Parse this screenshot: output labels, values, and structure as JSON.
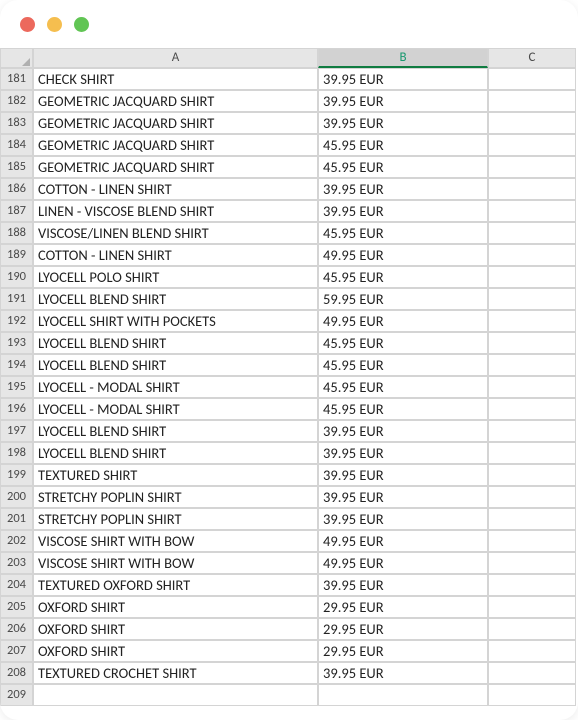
{
  "titlebar": {
    "close": "",
    "minimize": "",
    "zoom": ""
  },
  "chart_data": {
    "type": "table",
    "title": "",
    "columns": [
      "A",
      "B"
    ],
    "rows": [
      {
        "row": 181,
        "A": "CHECK SHIRT",
        "B": "39.95 EUR"
      },
      {
        "row": 182,
        "A": "GEOMETRIC JACQUARD SHIRT",
        "B": "39.95 EUR"
      },
      {
        "row": 183,
        "A": "GEOMETRIC JACQUARD SHIRT",
        "B": "39.95 EUR"
      },
      {
        "row": 184,
        "A": "GEOMETRIC JACQUARD SHIRT",
        "B": "45.95 EUR"
      },
      {
        "row": 185,
        "A": "GEOMETRIC JACQUARD SHIRT",
        "B": "45.95 EUR"
      },
      {
        "row": 186,
        "A": "COTTON - LINEN SHIRT",
        "B": "39.95 EUR"
      },
      {
        "row": 187,
        "A": "LINEN - VISCOSE BLEND SHIRT",
        "B": "39.95 EUR"
      },
      {
        "row": 188,
        "A": "VISCOSE/LINEN BLEND SHIRT",
        "B": "45.95 EUR"
      },
      {
        "row": 189,
        "A": "COTTON - LINEN SHIRT",
        "B": "49.95 EUR"
      },
      {
        "row": 190,
        "A": "LYOCELL POLO SHIRT",
        "B": "45.95 EUR"
      },
      {
        "row": 191,
        "A": "LYOCELL BLEND SHIRT",
        "B": "59.95 EUR"
      },
      {
        "row": 192,
        "A": "LYOCELL SHIRT WITH POCKETS",
        "B": "49.95 EUR"
      },
      {
        "row": 193,
        "A": "LYOCELL BLEND SHIRT",
        "B": "45.95 EUR"
      },
      {
        "row": 194,
        "A": "LYOCELL BLEND SHIRT",
        "B": "45.95 EUR"
      },
      {
        "row": 195,
        "A": "LYOCELL - MODAL SHIRT",
        "B": "45.95 EUR"
      },
      {
        "row": 196,
        "A": "LYOCELL - MODAL SHIRT",
        "B": "45.95 EUR"
      },
      {
        "row": 197,
        "A": "LYOCELL BLEND SHIRT",
        "B": "39.95 EUR"
      },
      {
        "row": 198,
        "A": "LYOCELL BLEND SHIRT",
        "B": "39.95 EUR"
      },
      {
        "row": 199,
        "A": "TEXTURED SHIRT",
        "B": "39.95 EUR"
      },
      {
        "row": 200,
        "A": "STRETCHY POPLIN SHIRT",
        "B": "39.95 EUR"
      },
      {
        "row": 201,
        "A": "STRETCHY POPLIN SHIRT",
        "B": "39.95 EUR"
      },
      {
        "row": 202,
        "A": "VISCOSE SHIRT WITH BOW",
        "B": "49.95 EUR"
      },
      {
        "row": 203,
        "A": "VISCOSE SHIRT WITH BOW",
        "B": "49.95 EUR"
      },
      {
        "row": 204,
        "A": "TEXTURED OXFORD SHIRT",
        "B": "39.95 EUR"
      },
      {
        "row": 205,
        "A": "OXFORD SHIRT",
        "B": "29.95 EUR"
      },
      {
        "row": 206,
        "A": "OXFORD SHIRT",
        "B": "29.95 EUR"
      },
      {
        "row": 207,
        "A": "OXFORD SHIRT",
        "B": "29.95 EUR"
      },
      {
        "row": 208,
        "A": "TEXTURED CROCHET SHIRT",
        "B": "39.95 EUR"
      },
      {
        "row": 209,
        "A": "",
        "B": ""
      }
    ]
  },
  "columns": {
    "A": "A",
    "B": "B",
    "C": "C"
  },
  "selected_column": "B"
}
